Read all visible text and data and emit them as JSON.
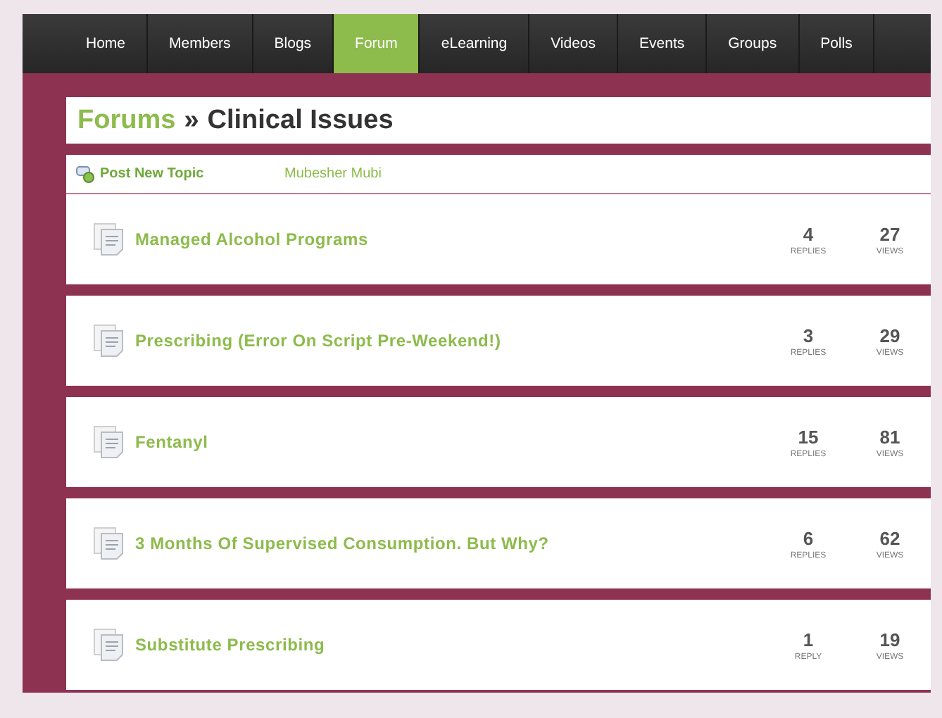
{
  "nav": [
    {
      "label": "Home",
      "selected": false
    },
    {
      "label": "Members",
      "selected": false
    },
    {
      "label": "Blogs",
      "selected": false
    },
    {
      "label": "Forum",
      "selected": true
    },
    {
      "label": "eLearning",
      "selected": false
    },
    {
      "label": "Videos",
      "selected": false
    },
    {
      "label": "Events",
      "selected": false
    },
    {
      "label": "Groups",
      "selected": false
    },
    {
      "label": "Polls",
      "selected": false
    }
  ],
  "breadcrumb": {
    "parent": "Forums",
    "separator": "»",
    "current": "Clinical Issues"
  },
  "toolbar": {
    "post_button": "Post New Topic",
    "user": "Mubesher Mubi"
  },
  "topics": [
    {
      "title": "Managed Alcohol Programs",
      "replies": "4",
      "replies_label": "REPLIES",
      "views": "27",
      "views_label": "VIEWS"
    },
    {
      "title": "Prescribing (Error On Script Pre-Weekend!)",
      "replies": "3",
      "replies_label": "REPLIES",
      "views": "29",
      "views_label": "VIEWS"
    },
    {
      "title": "Fentanyl",
      "replies": "15",
      "replies_label": "REPLIES",
      "views": "81",
      "views_label": "VIEWS"
    },
    {
      "title": "3 Months Of Supervised Consumption. But Why?",
      "replies": "6",
      "replies_label": "REPLIES",
      "views": "62",
      "views_label": "VIEWS"
    },
    {
      "title": "Substitute Prescribing",
      "replies": "1",
      "replies_label": "REPLY",
      "views": "19",
      "views_label": "VIEWS"
    }
  ]
}
